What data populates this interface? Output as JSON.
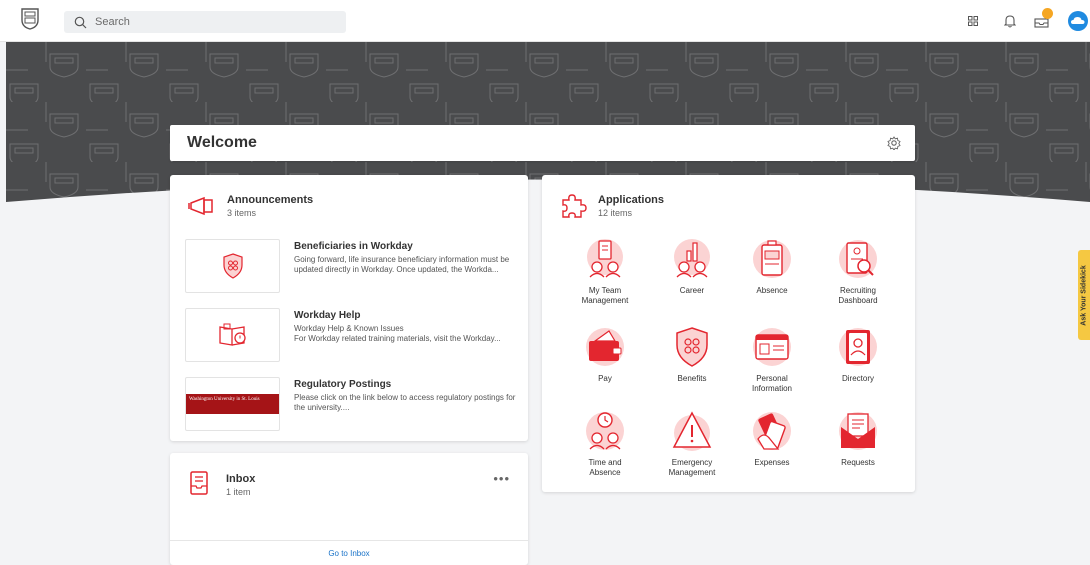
{
  "header": {
    "search_placeholder": "Search",
    "icons": [
      "university-logo",
      "apps-grid-icon",
      "bell-icon",
      "inbox-tray-icon",
      "profile-cloud-icon"
    ],
    "notification_badge_color": "#f5a623"
  },
  "welcome": {
    "title": "Welcome"
  },
  "announcements": {
    "title": "Announcements",
    "count": "3 items",
    "items": [
      {
        "title": "Beneficiaries in Workday",
        "body": "Going forward, life insurance beneficiary information must be updated directly in Workday.  Once updated, the Workda..."
      },
      {
        "title": "Workday Help",
        "body": "Workday Help & Known Issues\nFor Workday related training materials, visit the Workday..."
      },
      {
        "title": "Regulatory Postings",
        "body": "Please click on the link below to access regulatory postings for the university...."
      }
    ],
    "banner_text": "Washington University in St. Louis"
  },
  "inbox": {
    "title": "Inbox",
    "count": "1 item",
    "more": "•••",
    "footer": "Go to Inbox"
  },
  "applications": {
    "title": "Applications",
    "count": "12 items",
    "apps": [
      {
        "label": "My Team\nManagement",
        "icon": "team-management-icon"
      },
      {
        "label": "Career",
        "icon": "career-icon"
      },
      {
        "label": "Absence",
        "icon": "absence-icon"
      },
      {
        "label": "Recruiting\nDashboard",
        "icon": "recruiting-icon"
      },
      {
        "label": "Pay",
        "icon": "pay-icon"
      },
      {
        "label": "Benefits",
        "icon": "benefits-icon"
      },
      {
        "label": "Personal\nInformation",
        "icon": "personal-info-icon"
      },
      {
        "label": "Directory",
        "icon": "directory-icon"
      },
      {
        "label": "Time and\nAbsence",
        "icon": "time-absence-icon"
      },
      {
        "label": "Emergency\nManagement",
        "icon": "emergency-icon"
      },
      {
        "label": "Expenses",
        "icon": "expenses-icon"
      },
      {
        "label": "Requests",
        "icon": "requests-icon"
      }
    ]
  },
  "sidekick": {
    "label": "Ask Your Sidekick"
  },
  "colors": {
    "accent": "#e3262f",
    "accent_light": "#fbd3d3",
    "hero_dark": "#4a4b4d",
    "link": "#1a73c8",
    "sidekick": "#f5c842"
  }
}
